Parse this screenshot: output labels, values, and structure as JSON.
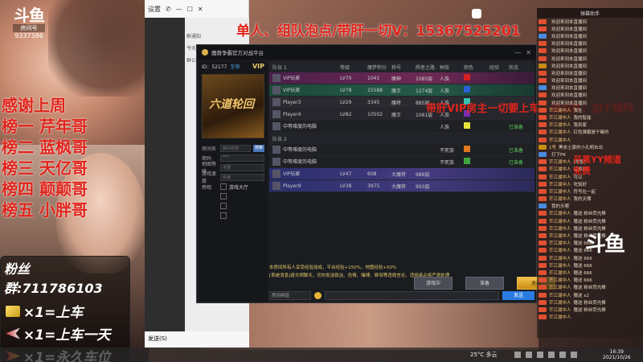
{
  "stream": {
    "logo": "斗鱼",
    "room_label": "房间号",
    "room_number": "9337386"
  },
  "headline": "单人、组队泡点/带肝一切V：15367525201",
  "ranking": [
    "感谢上周",
    "榜一 芹年哥",
    "榜二 蓝枫哥",
    "榜三 天亿哥",
    "榜四 颠颠哥",
    "榜五 小胖哥"
  ],
  "fans": {
    "title": "粉丝群:711786103",
    "rows": [
      {
        "icon": "gold-ticket-icon",
        "text": "×1=上车"
      },
      {
        "icon": "plane-icon",
        "text": "×1=上车一天"
      },
      {
        "icon": "rocket-icon",
        "text": "×1=永久车位"
      }
    ]
  },
  "chat_window": {
    "settings_label": "设置",
    "bottom_label": "发送(S)",
    "messages": [
      "群通知",
      "今天",
      "群公告"
    ]
  },
  "game": {
    "title": "魔兽争霸官方对战平台",
    "id_label": "ID：52177",
    "id_link": "至尊",
    "vip": "VIP",
    "banner_text": "六道轮回",
    "form": [
      {
        "label": "房间名",
        "placeholder": "房间名称"
      },
      {
        "label": "密码",
        "placeholder": "***"
      },
      {
        "label": "地图等级",
        "placeholder": "不限"
      },
      {
        "label": "游戏速度",
        "placeholder": "快速"
      }
    ],
    "form_extra": [
      "旁观",
      "游戏大厅"
    ],
    "search_btn": "搜索",
    "team1_label": "队伍 1",
    "team2_label": "队伍 2",
    "columns": [
      "等级",
      "魔梦积分",
      "称号",
      "陨者之路",
      "种族",
      "颜色",
      "经验",
      "状态"
    ],
    "team1": [
      {
        "name": "VIP玩家",
        "level": "LV70",
        "score": "1041",
        "title": "魔神",
        "path": "1085层",
        "race": "人族",
        "color": "#d42020",
        "exp": "",
        "status": ""
      },
      {
        "name": "VIP玩家",
        "level": "LV78",
        "score": "15588",
        "title": "魔王",
        "path": "1274层",
        "race": "人族",
        "color": "#2b5fd8",
        "exp": "",
        "status": ""
      },
      {
        "name": "Player3",
        "level": "LV29",
        "score": "3345",
        "title": "魔将",
        "path": "885层",
        "race": "人族",
        "color": "#31c2b0",
        "exp": "",
        "status": ""
      },
      {
        "name": "Player4",
        "level": "LV82",
        "score": "10502",
        "title": "魔王",
        "path": "1061层",
        "race": "人族",
        "color": "#7a2db8",
        "exp": "",
        "status": ""
      },
      {
        "name": "中等难度的电脑",
        "level": "",
        "score": "",
        "title": "",
        "path": "",
        "race": "人族",
        "color": "#e8e23a",
        "exp": "",
        "status": "已准备"
      }
    ],
    "team2": [
      {
        "name": "中等难度的电脑",
        "level": "",
        "score": "",
        "title": "",
        "path": "",
        "race": "不死族",
        "color": "#e07a1c",
        "exp": "",
        "status": "已准备"
      },
      {
        "name": "中等难度的电脑",
        "level": "",
        "score": "",
        "title": "",
        "path": "",
        "race": "不死族",
        "color": "#3ea83e",
        "exp": "",
        "status": "已准备"
      },
      {
        "name": "VIP玩家",
        "level": "LV47",
        "score": "608",
        "title": "大魔将",
        "path": "989层",
        "race": "",
        "color": "",
        "exp": "",
        "status": ""
      },
      {
        "name": "Player9",
        "level": "LV38",
        "score": "3975",
        "title": "大魔将",
        "path": "993层",
        "race": "",
        "color": "",
        "exp": "",
        "status": ""
      }
    ],
    "buttons": {
      "spectate": "游戏中",
      "ready": "准备",
      "start": "退出"
    },
    "system_messages": [
      "本房间所有人享受经验加成，平台经验+150%，地图经验+50%",
      "[系统消息]请文明聊天，切勿发送政治、色情、赌博、辱骂等违规言论，违规者必将严肃处理"
    ],
    "chat_select": "房间频道",
    "send": "发送"
  },
  "overlay_red": "带肝VIP房主一切要上车，请加群：加个钱吗",
  "right_chat": {
    "header": "弹幕助手",
    "items": [
      {
        "badge": "b1",
        "name": "",
        "text": "欢迎来到本直播间"
      },
      {
        "badge": "b1",
        "name": "",
        "text": "欢迎来到本直播间"
      },
      {
        "badge": "b2",
        "name": "",
        "text": "欢迎来到本直播间"
      },
      {
        "badge": "b1",
        "name": "",
        "text": "欢迎来到本直播间"
      },
      {
        "badge": "b1",
        "name": "",
        "text": "欢迎来到本直播间"
      },
      {
        "badge": "b1",
        "name": "",
        "text": "欢迎来到本直播间"
      },
      {
        "badge": "b3",
        "name": "",
        "text": "欢迎来到本直播间"
      },
      {
        "badge": "b1",
        "name": "",
        "text": "欢迎来到本直播间"
      },
      {
        "badge": "b1",
        "name": "",
        "text": "欢迎来到本直播间"
      },
      {
        "badge": "b2",
        "name": "",
        "text": "欢迎来到本直播间"
      },
      {
        "badge": "b1",
        "name": "",
        "text": "欢迎来到本直播间"
      },
      {
        "badge": "b1",
        "name": "",
        "text": "欢迎来到本直播间"
      },
      {
        "badge": "b1",
        "name": "芒江湖中人",
        "text": "我在"
      },
      {
        "badge": "b1",
        "name": "芒江湖中人",
        "text": "我的智能"
      },
      {
        "badge": "b1",
        "name": "芒江湖中人",
        "text": "我到家"
      },
      {
        "badge": "b1",
        "name": "芒江湖中人",
        "text": "红色弹幕是干嘛的"
      },
      {
        "badge": "b1",
        "name": "芒江湖中人",
        "text": ""
      },
      {
        "badge": "b3",
        "name": "1号",
        "text": "黑衣土豪的小孔明去出"
      },
      {
        "badge": "b2",
        "name": "",
        "text": "打下PK"
      },
      {
        "badge": "b1",
        "name": "芒江湖中人",
        "text": "[吃饭]"
      },
      {
        "badge": "b1",
        "name": "芒江湖中人",
        "text": "没事的"
      },
      {
        "badge": "b1",
        "name": "芒江湖中人",
        "text": "可以"
      },
      {
        "badge": "b1",
        "name": "芒江湖中人",
        "text": "吃饭好"
      },
      {
        "badge": "b1",
        "name": "芒江湖中人",
        "text": "符号在一起"
      },
      {
        "badge": "b1",
        "name": "芒江湖中人",
        "text": "我的天哪"
      },
      {
        "badge": "b2",
        "name": "",
        "text": "我的天哪"
      },
      {
        "badge": "b1",
        "name": "芒江湖中人",
        "text": "赠送 粉丝荧光棒"
      },
      {
        "badge": "b1",
        "name": "芒江湖中人",
        "text": "赠送 粉丝荧光棒"
      },
      {
        "badge": "b1",
        "name": "芒江湖中人",
        "text": "赠送 粉丝荧光棒"
      },
      {
        "badge": "b1",
        "name": "芒江湖中人",
        "text": "赠送 粉丝荧光棒"
      },
      {
        "badge": "b1",
        "name": "芒江湖中人",
        "text": "赠送 666"
      },
      {
        "badge": "b1",
        "name": "芒江湖中人",
        "text": "赠送 666"
      },
      {
        "badge": "b1",
        "name": "芒江湖中人",
        "text": "赠送 666"
      },
      {
        "badge": "b1",
        "name": "芒江湖中人",
        "text": "赠送 666"
      },
      {
        "badge": "b1",
        "name": "芒江湖中人",
        "text": "赠送 666"
      },
      {
        "badge": "b1",
        "name": "芒江湖中人",
        "text": "赠送 666"
      },
      {
        "badge": "b1",
        "name": "芒江湖中人",
        "text": "赠送 粉丝荧光棒"
      },
      {
        "badge": "b1",
        "name": "芒江湖中人",
        "text": "赠送 x2"
      },
      {
        "badge": "b1",
        "name": "芒江湖中人",
        "text": "赠送 粉丝荧光棒"
      },
      {
        "badge": "b1",
        "name": "芒江湖中人",
        "text": "赠送 粉丝荧光棒"
      },
      {
        "badge": "b1",
        "name": "芒江湖中人",
        "text": ""
      }
    ]
  },
  "rchat_overlay": [
    "开黑YY频道",
    "免费"
  ],
  "right_logo": "斗鱼",
  "taskbar": {
    "weather": "25°C 多云",
    "time": "16:39",
    "date": "2021/10/26"
  }
}
